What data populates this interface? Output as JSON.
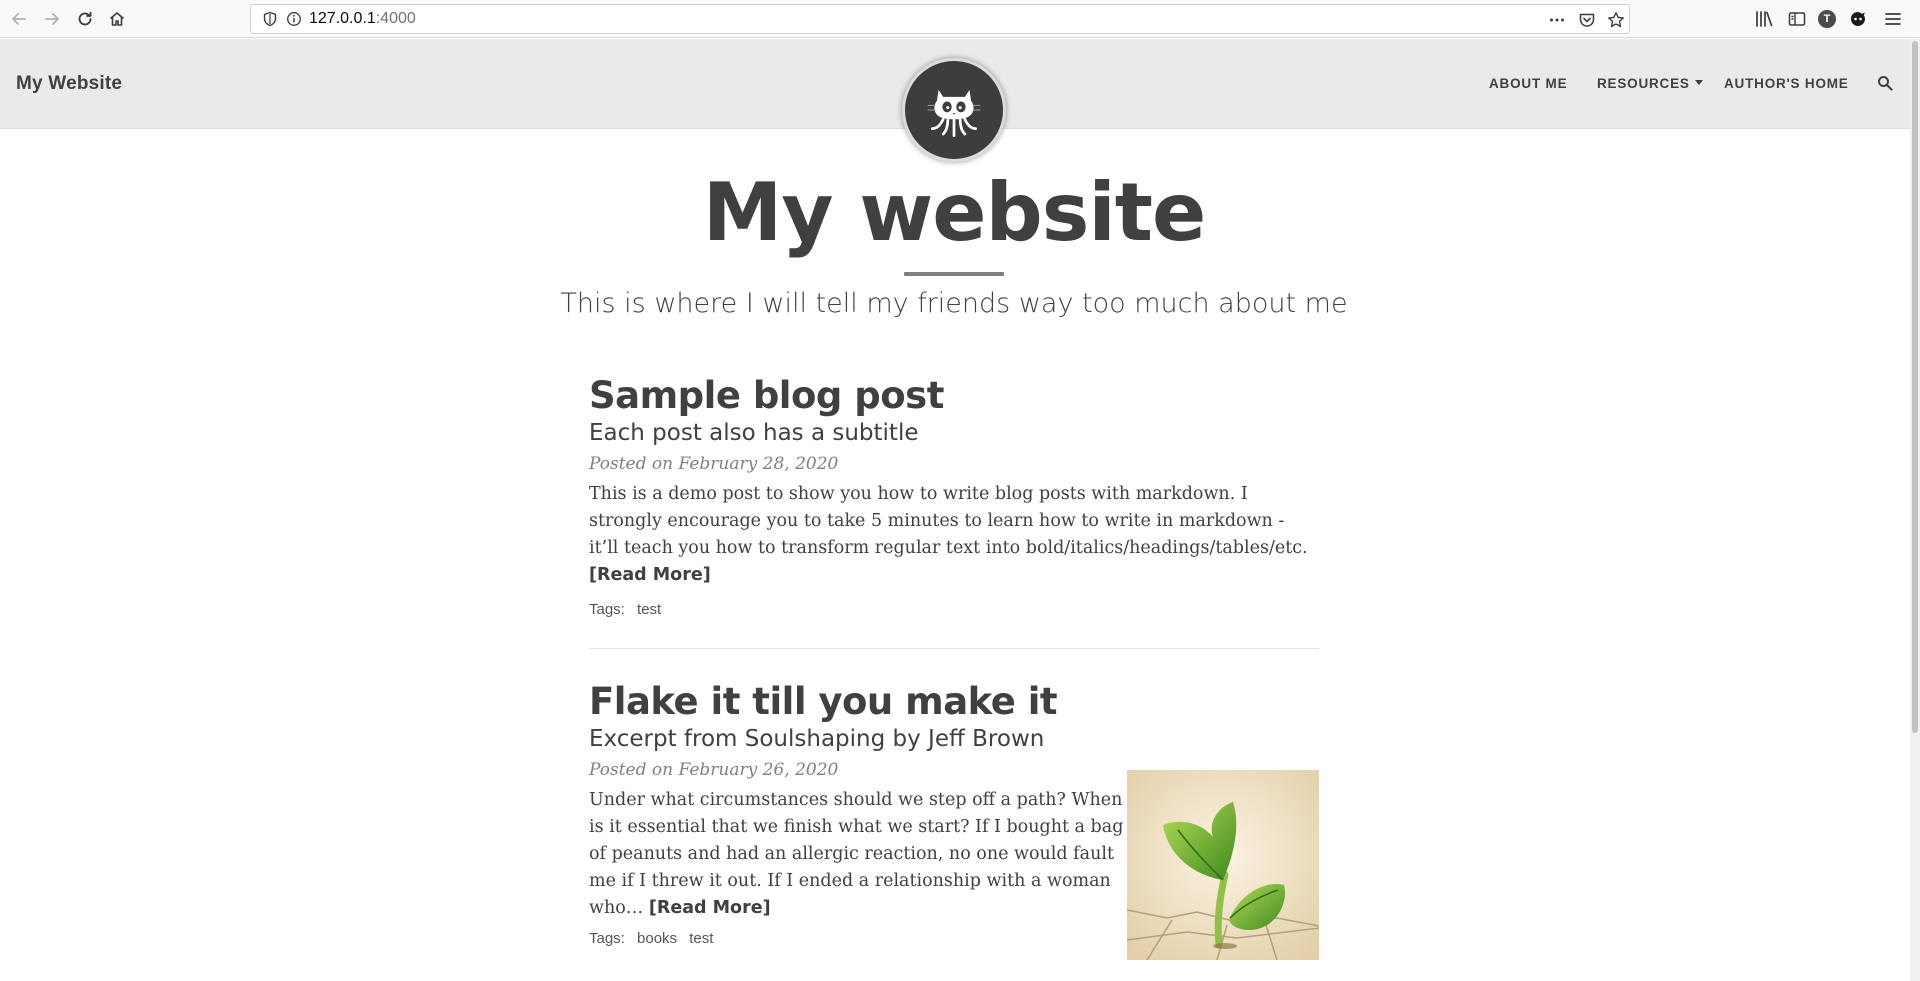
{
  "browser": {
    "url_host": "127.0.0.1",
    "url_port": ":4000",
    "account_initial": "T"
  },
  "nav": {
    "brand": "My Website",
    "links": [
      "ABOUT ME",
      "RESOURCES",
      "AUTHOR'S HOME"
    ]
  },
  "header": {
    "title": "My website",
    "subtitle": "This is where I will tell my friends way too much about me"
  },
  "posts": [
    {
      "title": "Sample blog post",
      "subtitle": "Each post also has a subtitle",
      "meta": "Posted on February 28, 2020",
      "excerpt": "This is a demo post to show you how to write blog posts with markdown. I strongly encourage you to take 5 minutes to learn how to write in markdown - it’ll teach you how to transform regular text into bold/italics/headings/tables/etc.",
      "read_more": "[Read More]",
      "tags_label": "Tags:",
      "tags": [
        "test"
      ]
    },
    {
      "title": "Flake it till you make it",
      "subtitle": "Excerpt from Soulshaping by Jeff Brown",
      "meta": "Posted on February 26, 2020",
      "excerpt": "Under what circumstances should we step off a path? When is it essential that we finish what we start? If I bought a bag of peanuts and had an allergic reaction, no one would fault me if I threw it out. If I ended a relationship with a woman who…",
      "read_more": "[Read More]",
      "tags_label": "Tags:",
      "tags": [
        "books",
        "test"
      ]
    }
  ]
}
